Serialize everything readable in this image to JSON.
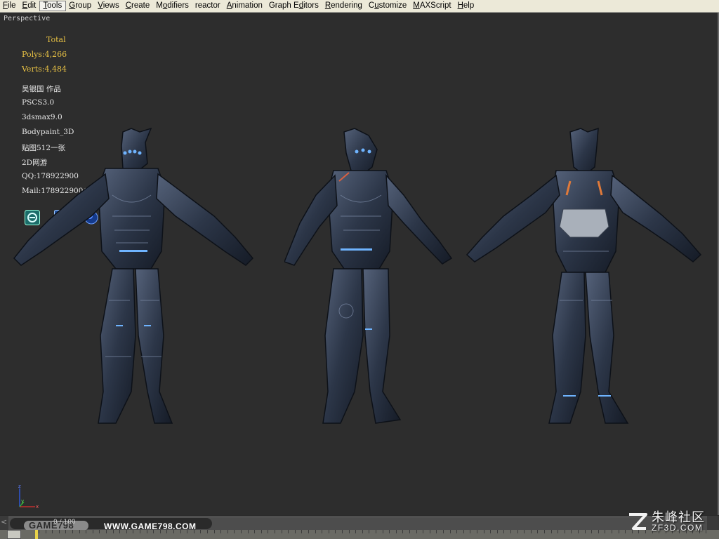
{
  "menu": {
    "items": [
      {
        "pre": "",
        "u": "F",
        "post": "ile"
      },
      {
        "pre": "",
        "u": "E",
        "post": "dit"
      },
      {
        "pre": "",
        "u": "T",
        "post": "ools"
      },
      {
        "pre": "",
        "u": "G",
        "post": "roup"
      },
      {
        "pre": "",
        "u": "V",
        "post": "iews"
      },
      {
        "pre": "",
        "u": "C",
        "post": "reate"
      },
      {
        "pre": "M",
        "u": "o",
        "post": "difiers"
      },
      {
        "pre": "reactor",
        "u": "",
        "post": ""
      },
      {
        "pre": "",
        "u": "A",
        "post": "nimation"
      },
      {
        "pre": "Graph E",
        "u": "d",
        "post": "itors"
      },
      {
        "pre": "",
        "u": "R",
        "post": "endering"
      },
      {
        "pre": "C",
        "u": "u",
        "post": "stomize"
      },
      {
        "pre": "",
        "u": "M",
        "post": "AXScript"
      },
      {
        "pre": "",
        "u": "H",
        "post": "elp"
      }
    ],
    "active_index": 2
  },
  "viewport": {
    "label": "Perspective",
    "stats": {
      "header": "Total",
      "polys": "Polys:4,266",
      "verts": "Verts:4,484"
    },
    "info_lines": [
      "吴银国 作品",
      "PSCS3.0",
      "3dsmax9.0",
      "Bodypaint_3D",
      "贴图512一张",
      "2D网游",
      "QQ:178922900",
      "Mail:178922900@qq.com"
    ],
    "app_icons": [
      "3dsmax-icon",
      "photoshop-icon",
      "bodypaint-icon"
    ],
    "axis": {
      "z": "z",
      "y": "y",
      "x": "x"
    }
  },
  "timeline": {
    "game_label": "GAME798",
    "frame_label": "0 / 100",
    "site_label": "WWW.GAME798.COM"
  },
  "watermark": {
    "cn": "朱峰社区",
    "en": "ZF3D.COM"
  },
  "colors": {
    "stats": "#e6c044",
    "viewport_bg": "#2d2d2d",
    "menu_bg": "#ece9d8",
    "armor": "#2f3a4a",
    "glow": "#6fb4ff"
  }
}
